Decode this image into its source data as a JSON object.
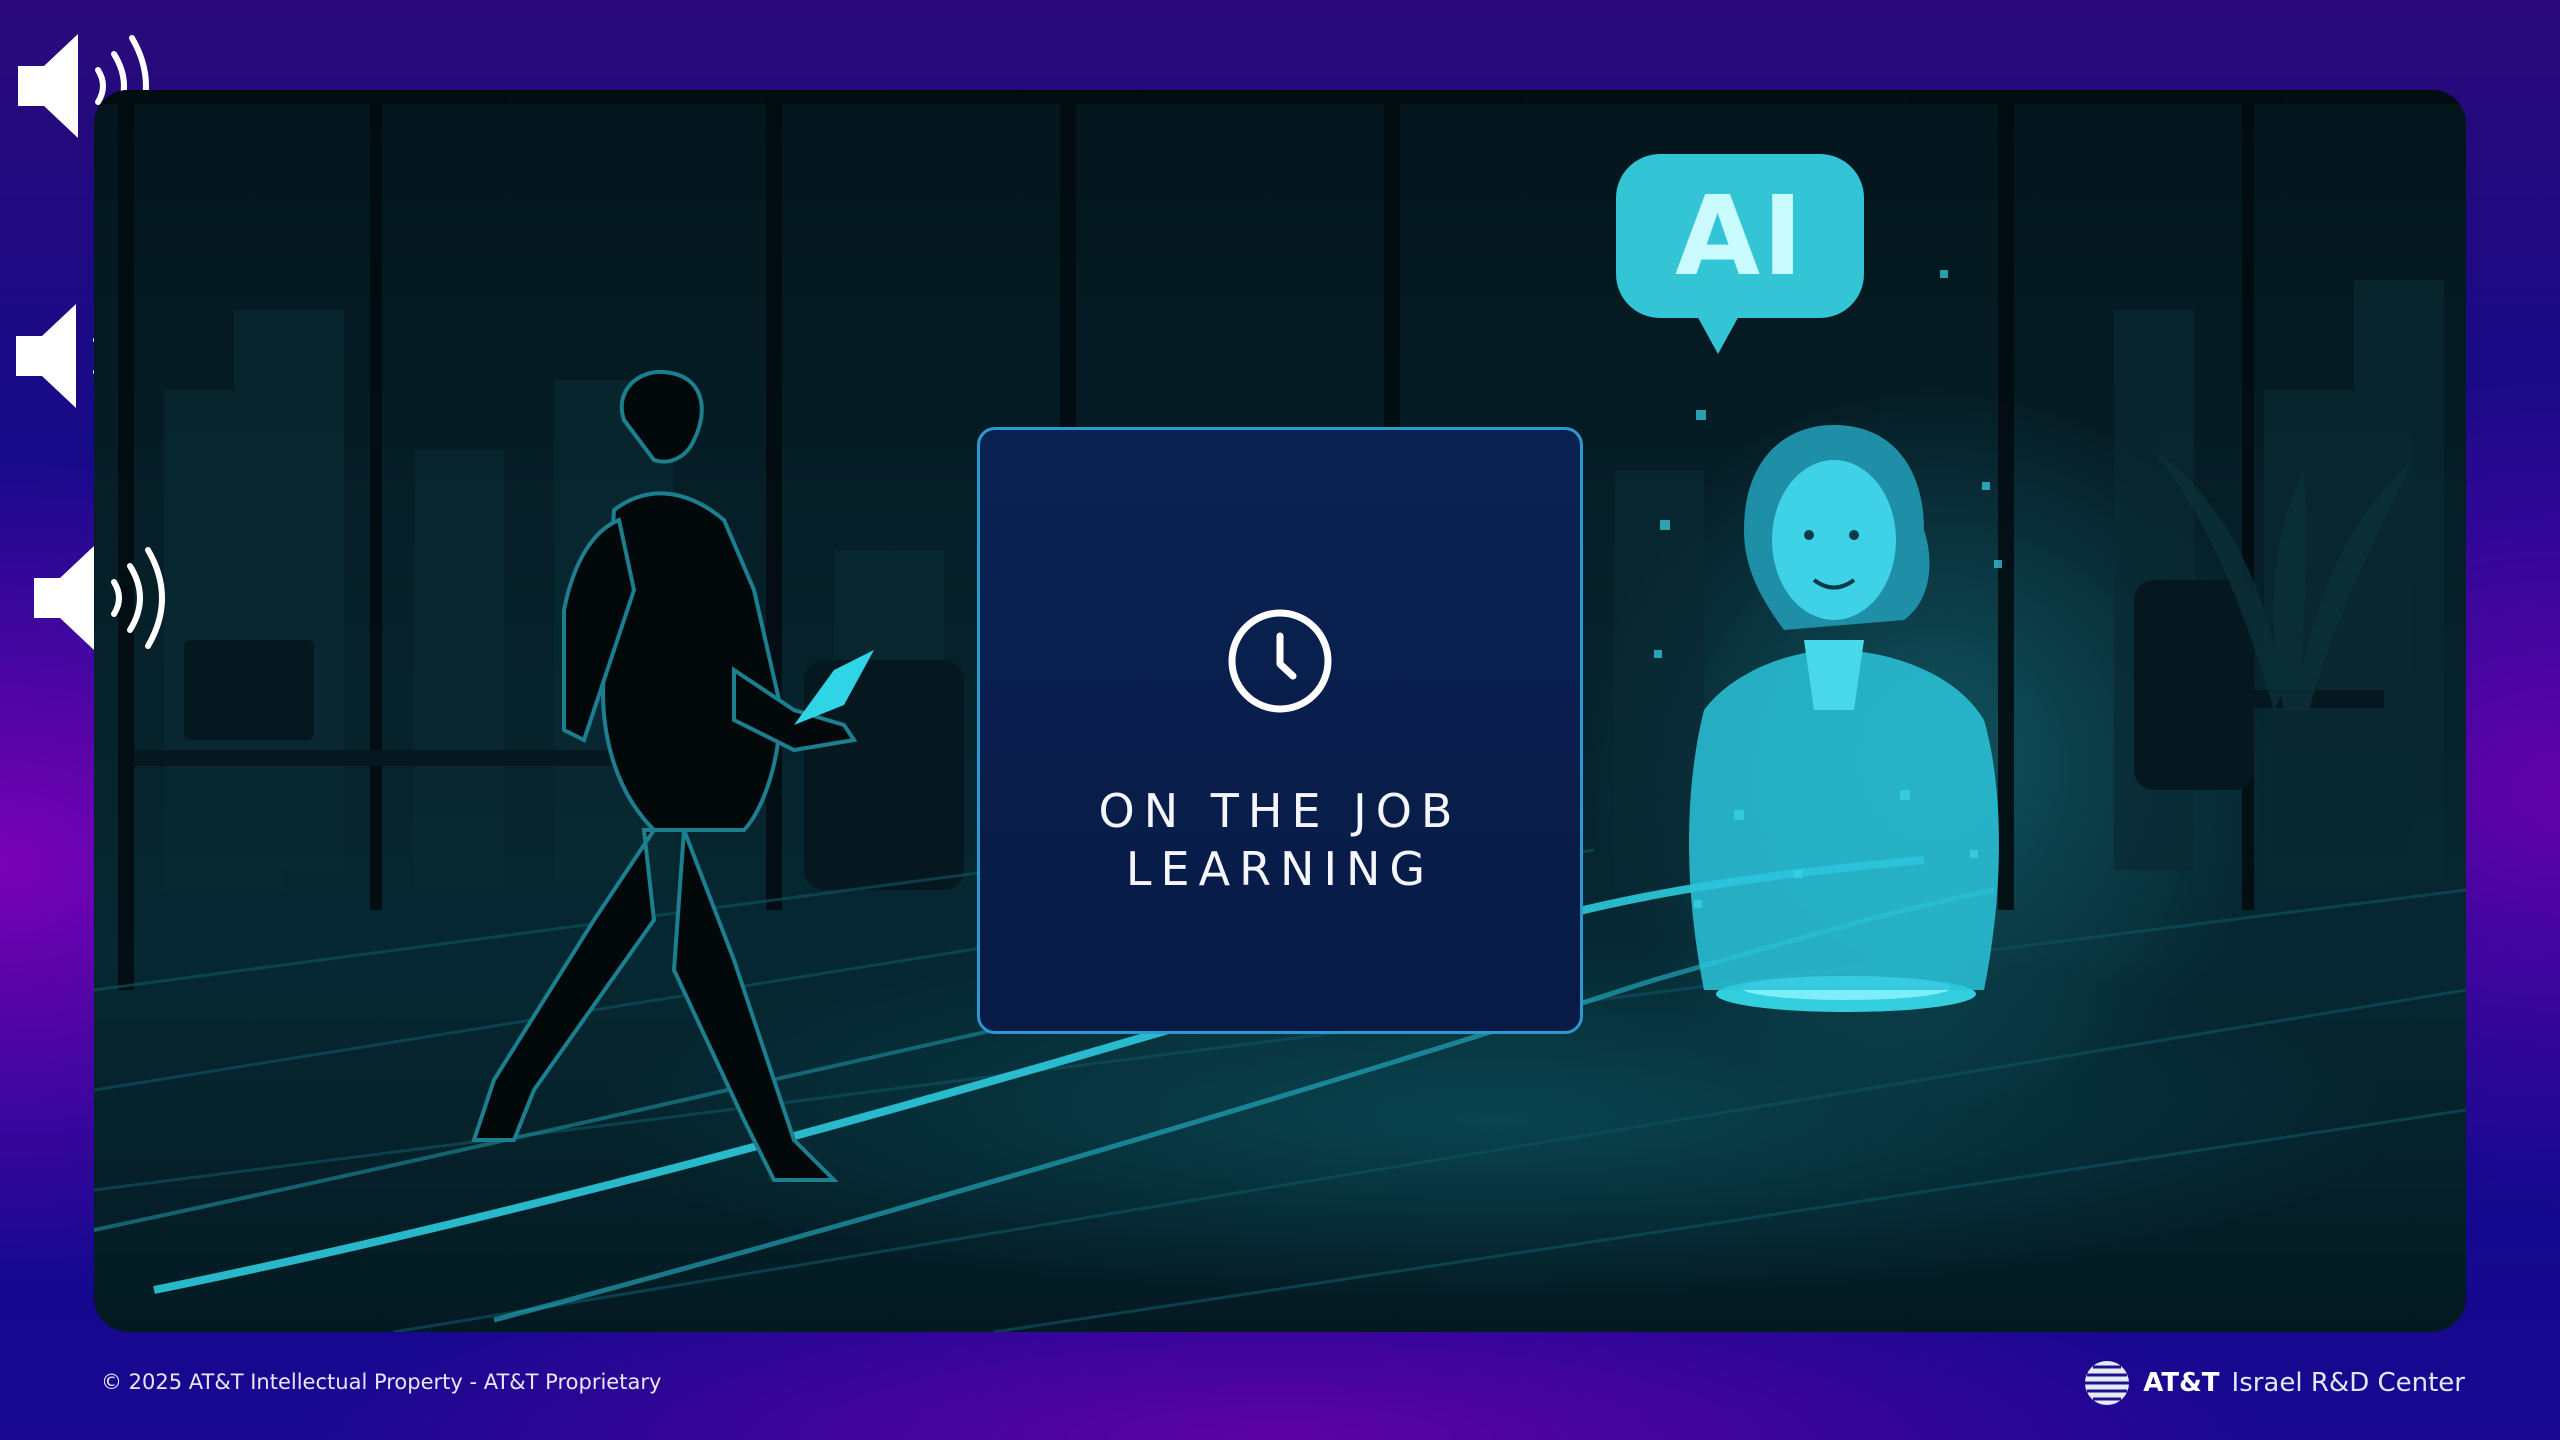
{
  "slide": {
    "card": {
      "icon": "clock-icon",
      "title_line1": "ON THE JOB",
      "title_line2": "LEARNING"
    },
    "illustration": {
      "speech_bubble_text": "AI"
    },
    "speakers": [
      {
        "icon": "speaker-icon"
      },
      {
        "icon": "speaker-icon"
      },
      {
        "icon": "speaker-icon"
      }
    ]
  },
  "footer": {
    "copyright": "© 2025 AT&T Intellectual Property - AT&T Proprietary",
    "brand_bold": "AT&T",
    "brand_rest": "Israel R&D Center"
  },
  "colors": {
    "accent_cyan": "#38d6e6",
    "card_fill": "#0a2252",
    "card_border": "#2a9ad0"
  }
}
